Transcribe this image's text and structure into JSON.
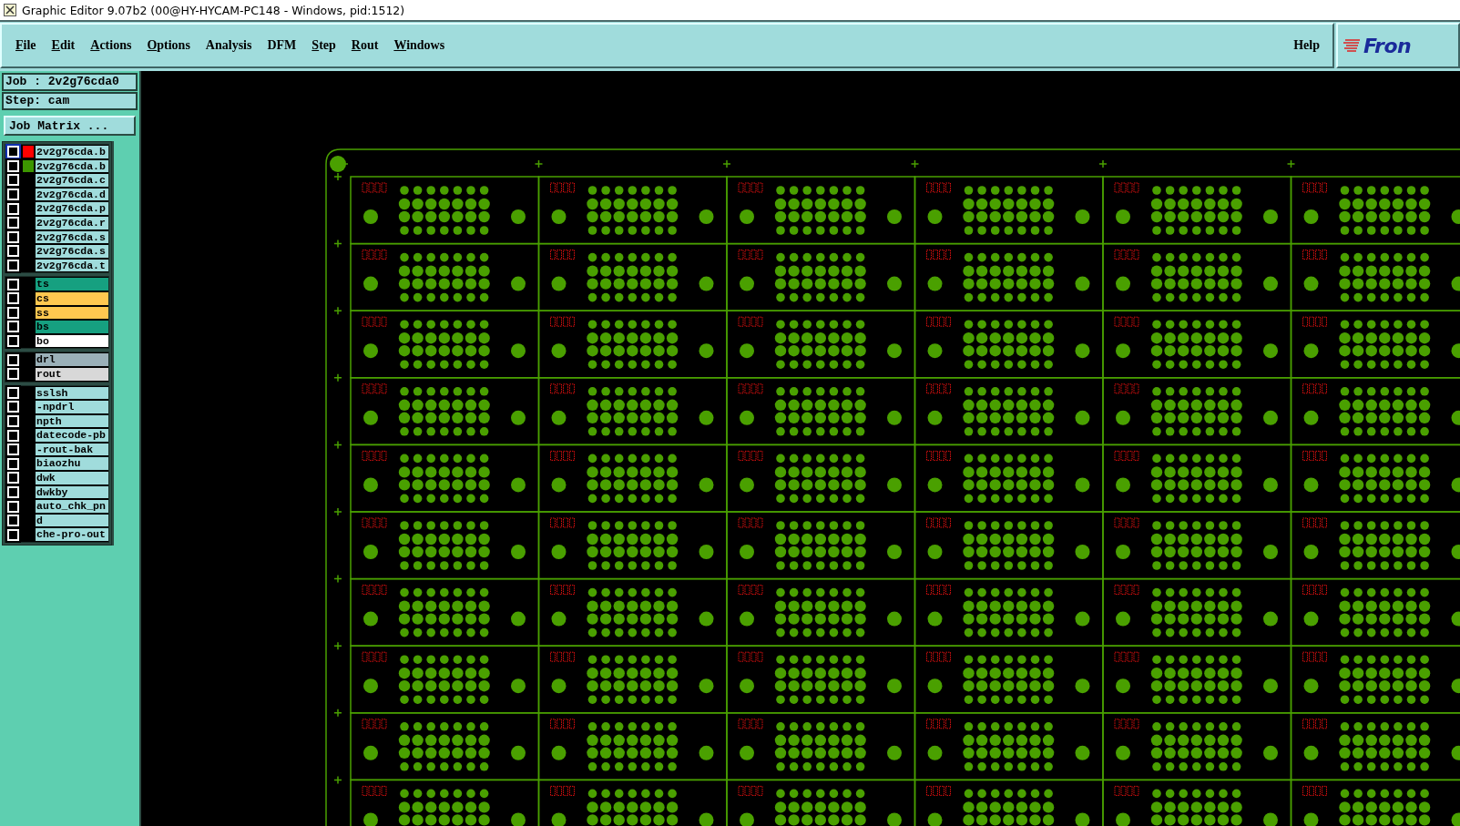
{
  "window": {
    "title": "Graphic Editor 9.07b2 (00@HY-HYCAM-PC148 - Windows, pid:1512)"
  },
  "menu": [
    {
      "label": "File",
      "mnemonic": true
    },
    {
      "label": "Edit",
      "mnemonic": true
    },
    {
      "label": "Actions",
      "mnemonic": true
    },
    {
      "label": "Options",
      "mnemonic": true
    },
    {
      "label": "Analysis",
      "mnemonic": false
    },
    {
      "label": "DFM",
      "mnemonic": false
    },
    {
      "label": "Step",
      "mnemonic": true
    },
    {
      "label": "Rout",
      "mnemonic": true
    },
    {
      "label": "Windows",
      "mnemonic": true
    }
  ],
  "help": "Help",
  "logo": {
    "text": "Fron"
  },
  "job": "Job : 2v2g76cda0",
  "step": "Step: cam",
  "job_matrix_button": "Job Matrix ...",
  "layer_groups": [
    {
      "layers": [
        {
          "name": "2v2g76cda.b",
          "checked": false,
          "focused": true,
          "color": "#ff0000",
          "kind": "misc"
        },
        {
          "name": "2v2g76cda.b",
          "checked": false,
          "focused": false,
          "color": "#3c9600",
          "kind": "misc"
        },
        {
          "name": "2v2g76cda.c",
          "checked": false,
          "focused": false,
          "kind": "misc"
        },
        {
          "name": "2v2g76cda.d",
          "checked": false,
          "focused": false,
          "kind": "misc"
        },
        {
          "name": "2v2g76cda.p",
          "checked": false,
          "focused": false,
          "kind": "misc"
        },
        {
          "name": "2v2g76cda.r",
          "checked": false,
          "focused": false,
          "kind": "misc"
        },
        {
          "name": "2v2g76cda.s",
          "checked": false,
          "focused": false,
          "kind": "misc"
        },
        {
          "name": "2v2g76cda.s",
          "checked": false,
          "focused": false,
          "kind": "misc"
        },
        {
          "name": "2v2g76cda.t",
          "checked": false,
          "focused": false,
          "kind": "misc"
        }
      ]
    },
    {
      "layers": [
        {
          "name": "ts",
          "checked": false,
          "focused": false,
          "kind": "mask"
        },
        {
          "name": "cs",
          "checked": false,
          "focused": false,
          "kind": "silk"
        },
        {
          "name": "ss",
          "checked": false,
          "focused": false,
          "kind": "silk"
        },
        {
          "name": "bs",
          "checked": false,
          "focused": false,
          "kind": "mask"
        },
        {
          "name": "bo",
          "checked": false,
          "focused": false,
          "kind": "board"
        }
      ]
    },
    {
      "layers": [
        {
          "name": "drl",
          "checked": false,
          "focused": false,
          "kind": "drill"
        },
        {
          "name": "rout",
          "checked": false,
          "focused": false,
          "kind": "rout"
        }
      ]
    },
    {
      "layers": [
        {
          "name": "sslsh",
          "checked": false,
          "focused": false,
          "kind": "misc"
        },
        {
          "name": "-npdrl",
          "checked": false,
          "focused": false,
          "kind": "misc"
        },
        {
          "name": "npth",
          "checked": false,
          "focused": false,
          "kind": "misc"
        },
        {
          "name": "datecode-pb",
          "checked": false,
          "focused": false,
          "kind": "misc"
        },
        {
          "name": "-rout-bak",
          "checked": false,
          "focused": false,
          "kind": "misc"
        },
        {
          "name": "biaozhu",
          "checked": false,
          "focused": false,
          "kind": "misc"
        },
        {
          "name": "dwk",
          "checked": false,
          "focused": false,
          "kind": "misc"
        },
        {
          "name": "dwkby",
          "checked": false,
          "focused": false,
          "kind": "misc"
        },
        {
          "name": "auto_chk_pn",
          "checked": false,
          "focused": false,
          "kind": "misc"
        },
        {
          "name": "d",
          "checked": false,
          "focused": false,
          "kind": "misc"
        },
        {
          "name": "che-pro-out",
          "checked": false,
          "focused": false,
          "kind": "misc"
        }
      ]
    }
  ],
  "canvas": {
    "kind": "pcb-panel"
  }
}
